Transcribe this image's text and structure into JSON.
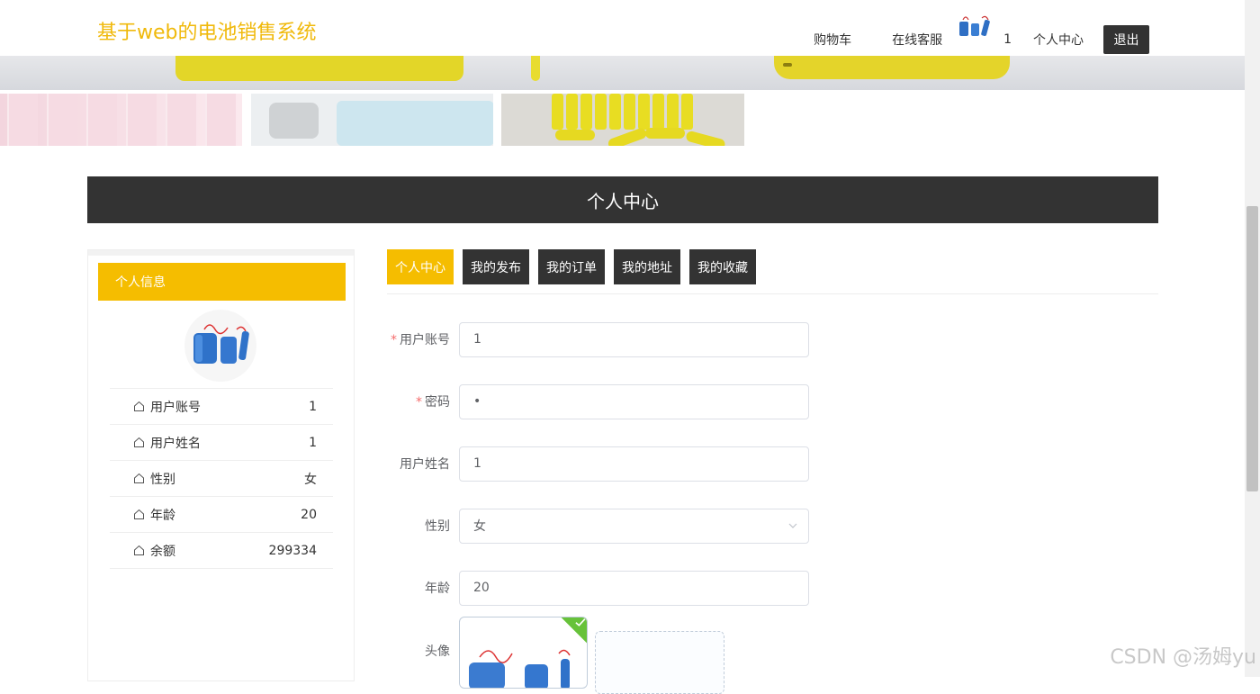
{
  "header": {
    "site_title": "基于web的电池销售系统",
    "nav": {
      "cart": "购物车",
      "service": "在线客服",
      "username": "1",
      "profile": "个人中心",
      "logout": "退出"
    }
  },
  "section_title": "个人中心",
  "info_card": {
    "title": "个人信息",
    "rows": [
      {
        "label": "用户账号",
        "value": "1"
      },
      {
        "label": "用户姓名",
        "value": "1"
      },
      {
        "label": "性别",
        "value": "女"
      },
      {
        "label": "年龄",
        "value": "20"
      },
      {
        "label": "余额",
        "value": "299334"
      }
    ]
  },
  "tabs": [
    "个人中心",
    "我的发布",
    "我的订单",
    "我的地址",
    "我的收藏"
  ],
  "form": {
    "account": {
      "label": "用户账号",
      "value": "1",
      "required": true
    },
    "password": {
      "label": "密码",
      "value": "•",
      "required": true
    },
    "name": {
      "label": "用户姓名",
      "value": "1"
    },
    "gender": {
      "label": "性别",
      "value": "女"
    },
    "age": {
      "label": "年龄",
      "value": "20"
    },
    "avatar": {
      "label": "头像"
    }
  },
  "colors": {
    "accent": "#f5bd00",
    "dark": "#333333",
    "title": "#f0b90b",
    "required": "#f56c6c"
  },
  "watermark": "CSDN @汤姆yu"
}
